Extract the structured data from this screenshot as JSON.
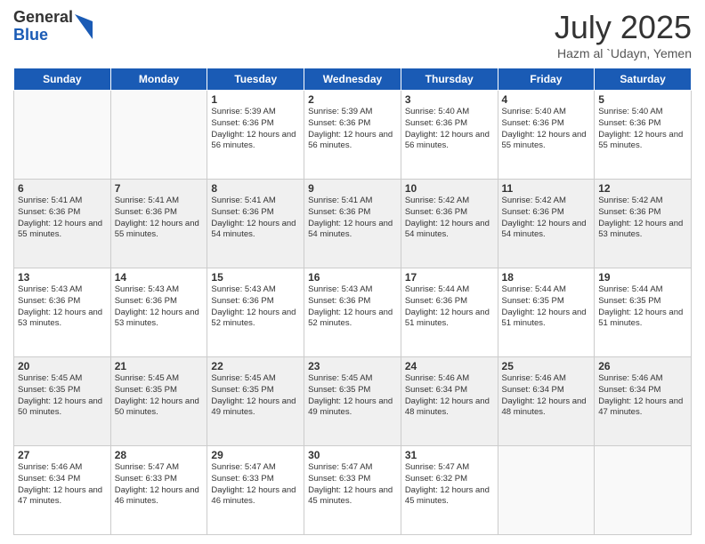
{
  "logo": {
    "general": "General",
    "blue": "Blue"
  },
  "header": {
    "month": "July 2025",
    "location": "Hazm al `Udayn, Yemen"
  },
  "weekdays": [
    "Sunday",
    "Monday",
    "Tuesday",
    "Wednesday",
    "Thursday",
    "Friday",
    "Saturday"
  ],
  "weeks": [
    [
      {
        "day": "",
        "sunrise": "",
        "sunset": "",
        "daylight": ""
      },
      {
        "day": "",
        "sunrise": "",
        "sunset": "",
        "daylight": ""
      },
      {
        "day": "1",
        "sunrise": "Sunrise: 5:39 AM",
        "sunset": "Sunset: 6:36 PM",
        "daylight": "Daylight: 12 hours and 56 minutes."
      },
      {
        "day": "2",
        "sunrise": "Sunrise: 5:39 AM",
        "sunset": "Sunset: 6:36 PM",
        "daylight": "Daylight: 12 hours and 56 minutes."
      },
      {
        "day": "3",
        "sunrise": "Sunrise: 5:40 AM",
        "sunset": "Sunset: 6:36 PM",
        "daylight": "Daylight: 12 hours and 56 minutes."
      },
      {
        "day": "4",
        "sunrise": "Sunrise: 5:40 AM",
        "sunset": "Sunset: 6:36 PM",
        "daylight": "Daylight: 12 hours and 55 minutes."
      },
      {
        "day": "5",
        "sunrise": "Sunrise: 5:40 AM",
        "sunset": "Sunset: 6:36 PM",
        "daylight": "Daylight: 12 hours and 55 minutes."
      }
    ],
    [
      {
        "day": "6",
        "sunrise": "Sunrise: 5:41 AM",
        "sunset": "Sunset: 6:36 PM",
        "daylight": "Daylight: 12 hours and 55 minutes."
      },
      {
        "day": "7",
        "sunrise": "Sunrise: 5:41 AM",
        "sunset": "Sunset: 6:36 PM",
        "daylight": "Daylight: 12 hours and 55 minutes."
      },
      {
        "day": "8",
        "sunrise": "Sunrise: 5:41 AM",
        "sunset": "Sunset: 6:36 PM",
        "daylight": "Daylight: 12 hours and 54 minutes."
      },
      {
        "day": "9",
        "sunrise": "Sunrise: 5:41 AM",
        "sunset": "Sunset: 6:36 PM",
        "daylight": "Daylight: 12 hours and 54 minutes."
      },
      {
        "day": "10",
        "sunrise": "Sunrise: 5:42 AM",
        "sunset": "Sunset: 6:36 PM",
        "daylight": "Daylight: 12 hours and 54 minutes."
      },
      {
        "day": "11",
        "sunrise": "Sunrise: 5:42 AM",
        "sunset": "Sunset: 6:36 PM",
        "daylight": "Daylight: 12 hours and 54 minutes."
      },
      {
        "day": "12",
        "sunrise": "Sunrise: 5:42 AM",
        "sunset": "Sunset: 6:36 PM",
        "daylight": "Daylight: 12 hours and 53 minutes."
      }
    ],
    [
      {
        "day": "13",
        "sunrise": "Sunrise: 5:43 AM",
        "sunset": "Sunset: 6:36 PM",
        "daylight": "Daylight: 12 hours and 53 minutes."
      },
      {
        "day": "14",
        "sunrise": "Sunrise: 5:43 AM",
        "sunset": "Sunset: 6:36 PM",
        "daylight": "Daylight: 12 hours and 53 minutes."
      },
      {
        "day": "15",
        "sunrise": "Sunrise: 5:43 AM",
        "sunset": "Sunset: 6:36 PM",
        "daylight": "Daylight: 12 hours and 52 minutes."
      },
      {
        "day": "16",
        "sunrise": "Sunrise: 5:43 AM",
        "sunset": "Sunset: 6:36 PM",
        "daylight": "Daylight: 12 hours and 52 minutes."
      },
      {
        "day": "17",
        "sunrise": "Sunrise: 5:44 AM",
        "sunset": "Sunset: 6:36 PM",
        "daylight": "Daylight: 12 hours and 51 minutes."
      },
      {
        "day": "18",
        "sunrise": "Sunrise: 5:44 AM",
        "sunset": "Sunset: 6:35 PM",
        "daylight": "Daylight: 12 hours and 51 minutes."
      },
      {
        "day": "19",
        "sunrise": "Sunrise: 5:44 AM",
        "sunset": "Sunset: 6:35 PM",
        "daylight": "Daylight: 12 hours and 51 minutes."
      }
    ],
    [
      {
        "day": "20",
        "sunrise": "Sunrise: 5:45 AM",
        "sunset": "Sunset: 6:35 PM",
        "daylight": "Daylight: 12 hours and 50 minutes."
      },
      {
        "day": "21",
        "sunrise": "Sunrise: 5:45 AM",
        "sunset": "Sunset: 6:35 PM",
        "daylight": "Daylight: 12 hours and 50 minutes."
      },
      {
        "day": "22",
        "sunrise": "Sunrise: 5:45 AM",
        "sunset": "Sunset: 6:35 PM",
        "daylight": "Daylight: 12 hours and 49 minutes."
      },
      {
        "day": "23",
        "sunrise": "Sunrise: 5:45 AM",
        "sunset": "Sunset: 6:35 PM",
        "daylight": "Daylight: 12 hours and 49 minutes."
      },
      {
        "day": "24",
        "sunrise": "Sunrise: 5:46 AM",
        "sunset": "Sunset: 6:34 PM",
        "daylight": "Daylight: 12 hours and 48 minutes."
      },
      {
        "day": "25",
        "sunrise": "Sunrise: 5:46 AM",
        "sunset": "Sunset: 6:34 PM",
        "daylight": "Daylight: 12 hours and 48 minutes."
      },
      {
        "day": "26",
        "sunrise": "Sunrise: 5:46 AM",
        "sunset": "Sunset: 6:34 PM",
        "daylight": "Daylight: 12 hours and 47 minutes."
      }
    ],
    [
      {
        "day": "27",
        "sunrise": "Sunrise: 5:46 AM",
        "sunset": "Sunset: 6:34 PM",
        "daylight": "Daylight: 12 hours and 47 minutes."
      },
      {
        "day": "28",
        "sunrise": "Sunrise: 5:47 AM",
        "sunset": "Sunset: 6:33 PM",
        "daylight": "Daylight: 12 hours and 46 minutes."
      },
      {
        "day": "29",
        "sunrise": "Sunrise: 5:47 AM",
        "sunset": "Sunset: 6:33 PM",
        "daylight": "Daylight: 12 hours and 46 minutes."
      },
      {
        "day": "30",
        "sunrise": "Sunrise: 5:47 AM",
        "sunset": "Sunset: 6:33 PM",
        "daylight": "Daylight: 12 hours and 45 minutes."
      },
      {
        "day": "31",
        "sunrise": "Sunrise: 5:47 AM",
        "sunset": "Sunset: 6:32 PM",
        "daylight": "Daylight: 12 hours and 45 minutes."
      },
      {
        "day": "",
        "sunrise": "",
        "sunset": "",
        "daylight": ""
      },
      {
        "day": "",
        "sunrise": "",
        "sunset": "",
        "daylight": ""
      }
    ]
  ]
}
